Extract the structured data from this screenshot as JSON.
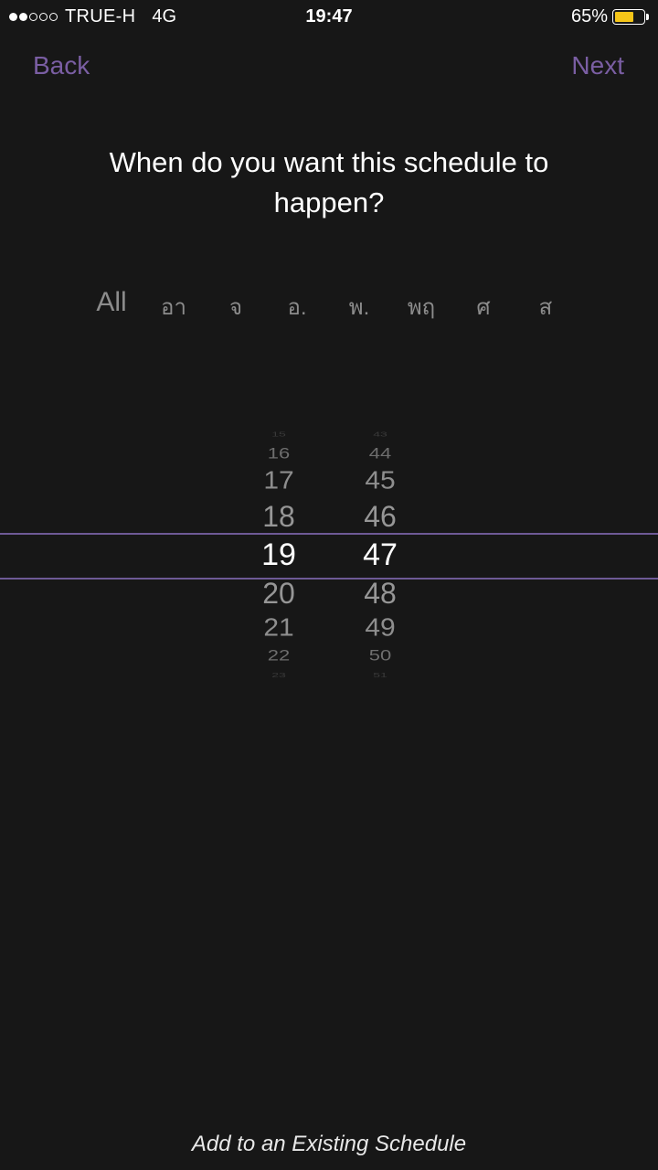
{
  "status_bar": {
    "carrier": "TRUE-H",
    "network": "4G",
    "time": "19:47",
    "battery_percent": "65%",
    "battery_level": 0.65,
    "battery_color": "#f5c518",
    "signal_filled": 2,
    "signal_total": 5
  },
  "nav": {
    "back_label": "Back",
    "next_label": "Next",
    "accent_color": "#7a5ea3"
  },
  "title": "When do you want this schedule to happen?",
  "days": [
    {
      "id": "all",
      "label": "All"
    },
    {
      "id": "sun",
      "label": "อา"
    },
    {
      "id": "mon",
      "label": "จ"
    },
    {
      "id": "tue",
      "label": "อ."
    },
    {
      "id": "wed",
      "label": "พ."
    },
    {
      "id": "thu",
      "label": "พฤ"
    },
    {
      "id": "fri",
      "label": "ศ"
    },
    {
      "id": "sat",
      "label": "ส"
    }
  ],
  "picker": {
    "hours": [
      "15",
      "16",
      "17",
      "18",
      "19",
      "20",
      "21",
      "22",
      "23"
    ],
    "minutes": [
      "43",
      "44",
      "45",
      "46",
      "47",
      "48",
      "49",
      "50",
      "51"
    ],
    "selected_hour": "19",
    "selected_minute": "47"
  },
  "footer": {
    "add_existing_label": "Add to an Existing Schedule"
  }
}
